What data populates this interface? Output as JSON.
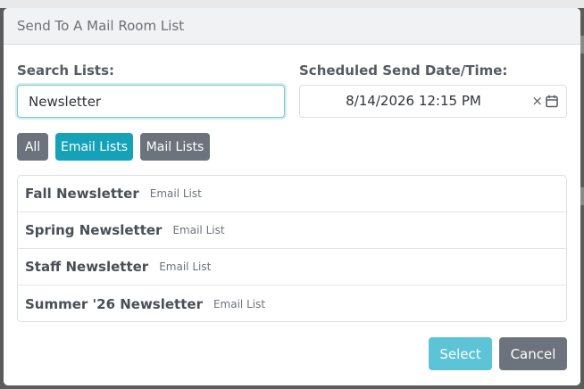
{
  "modal": {
    "title": "Send To A Mail Room List"
  },
  "search": {
    "label": "Search Lists:",
    "value": "Newsletter"
  },
  "schedule": {
    "label": "Scheduled Send Date/Time:",
    "value": "8/14/2026 12:15 PM",
    "clear_glyph": "×"
  },
  "filters": [
    {
      "label": "All",
      "active": false
    },
    {
      "label": "Email Lists",
      "active": true
    },
    {
      "label": "Mail Lists",
      "active": false
    }
  ],
  "lists": [
    {
      "name": "Fall Newsletter",
      "type": "Email List"
    },
    {
      "name": "Spring Newsletter",
      "type": "Email List"
    },
    {
      "name": "Staff Newsletter",
      "type": "Email List"
    },
    {
      "name": "Summer '26 Newsletter",
      "type": "Email List"
    }
  ],
  "footer": {
    "select_label": "Select",
    "cancel_label": "Cancel"
  },
  "colors": {
    "accent": "#15a2b8",
    "select_disabled": "#5cc4d6",
    "secondary": "#6c737c"
  }
}
